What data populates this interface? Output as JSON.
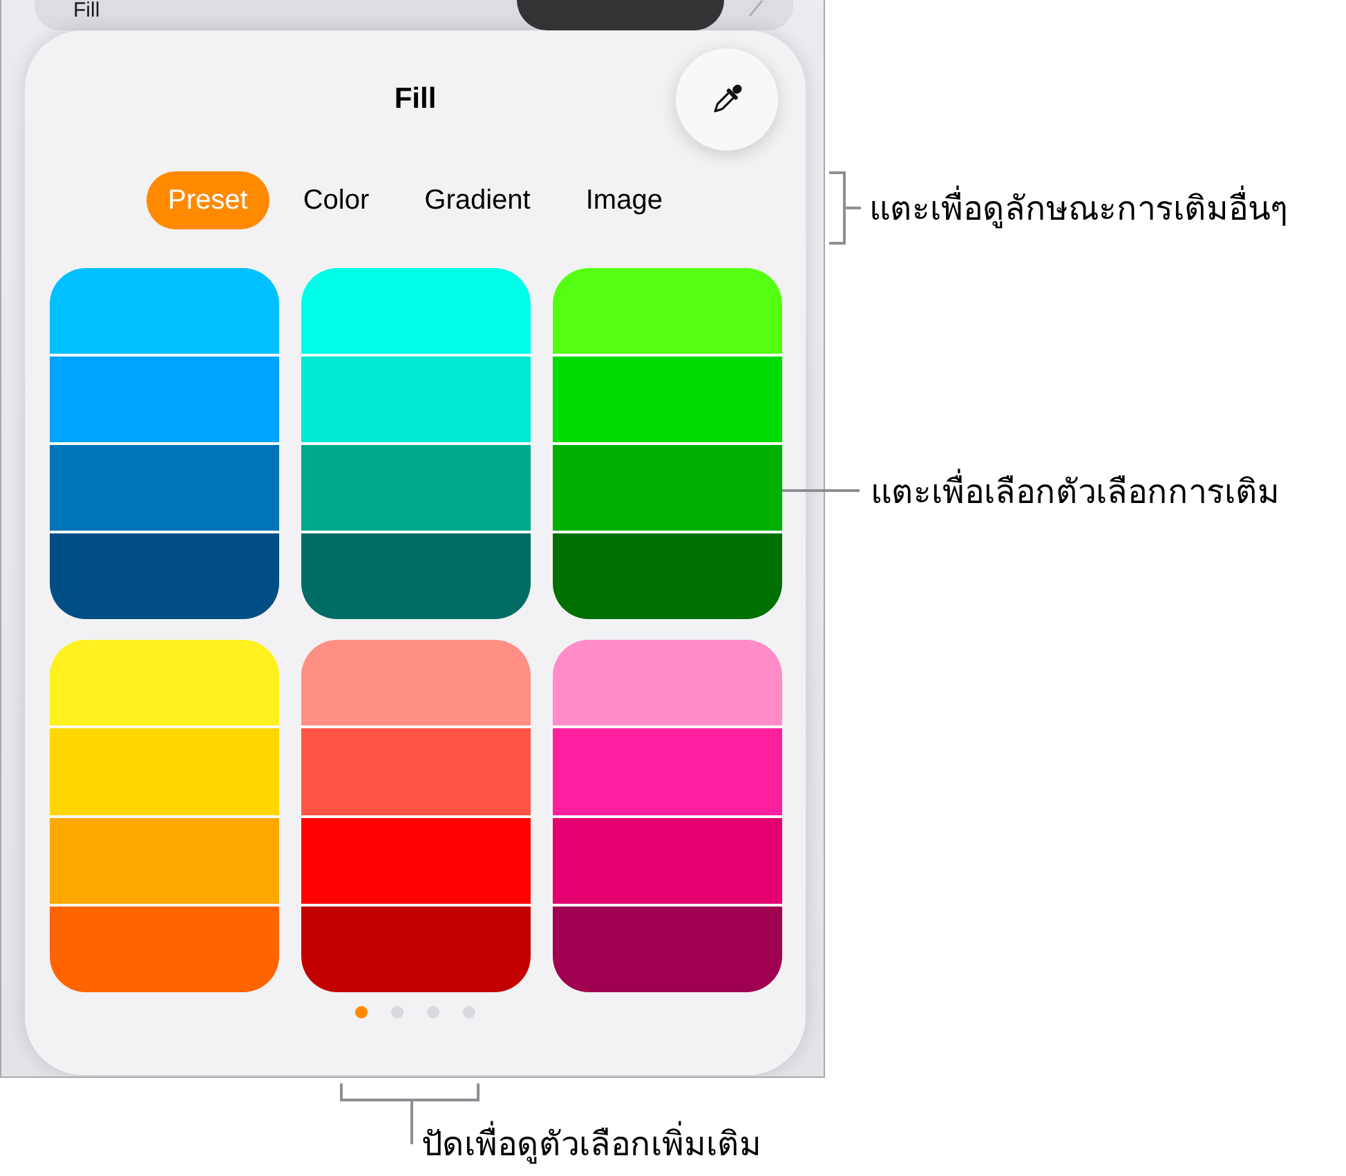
{
  "background_row": {
    "label": "Fill"
  },
  "panel": {
    "title": "Fill",
    "tabs": [
      {
        "label": "Preset",
        "selected": true
      },
      {
        "label": "Color",
        "selected": false
      },
      {
        "label": "Gradient",
        "selected": false
      },
      {
        "label": "Image",
        "selected": false
      }
    ],
    "swatches": [
      {
        "stripes": [
          {
            "color": "#00c0ff"
          },
          {
            "color": "#00a3ff"
          },
          {
            "color": "#0074b8"
          },
          {
            "color": "#004e86"
          }
        ]
      },
      {
        "stripes": [
          {
            "color": "#00fde8"
          },
          {
            "color": "#00e9d1"
          },
          {
            "color": "#00a98b"
          },
          {
            "color": "#006d63"
          }
        ]
      },
      {
        "stripes": [
          {
            "color": "#55ff14"
          },
          {
            "color": "#00dc00"
          },
          {
            "color": "#00b000"
          },
          {
            "color": "#007000"
          }
        ]
      },
      {
        "stripes": [
          {
            "color": "#fff020"
          },
          {
            "color": "#ffd600"
          },
          {
            "color": "#ffa800"
          },
          {
            "color": "#ff6400"
          }
        ]
      },
      {
        "stripes": [
          {
            "color": "#ff8e84"
          },
          {
            "color": "#ff5446"
          },
          {
            "color": "#ff0000"
          },
          {
            "color": "#c20000"
          }
        ]
      },
      {
        "stripes": [
          {
            "color": "#ff8cc8"
          },
          {
            "color": "#ff20a0"
          },
          {
            "color": "#e4006f"
          },
          {
            "color": "#a00050"
          }
        ]
      }
    ],
    "pages": [
      {
        "selected": true
      },
      {
        "selected": false
      },
      {
        "selected": false
      },
      {
        "selected": false
      }
    ]
  },
  "callouts": [
    {
      "kind": "bracket",
      "text": "แตะเพื่อดูลักษณะการเติมอื่นๆ"
    },
    {
      "kind": "line",
      "text": "แตะเพื่อเลือกตัวเลือกการเติม"
    },
    {
      "kind": "underbracket",
      "text": "ปัดเพื่อดูตัวเลือกเพิ่มเติม"
    }
  ]
}
